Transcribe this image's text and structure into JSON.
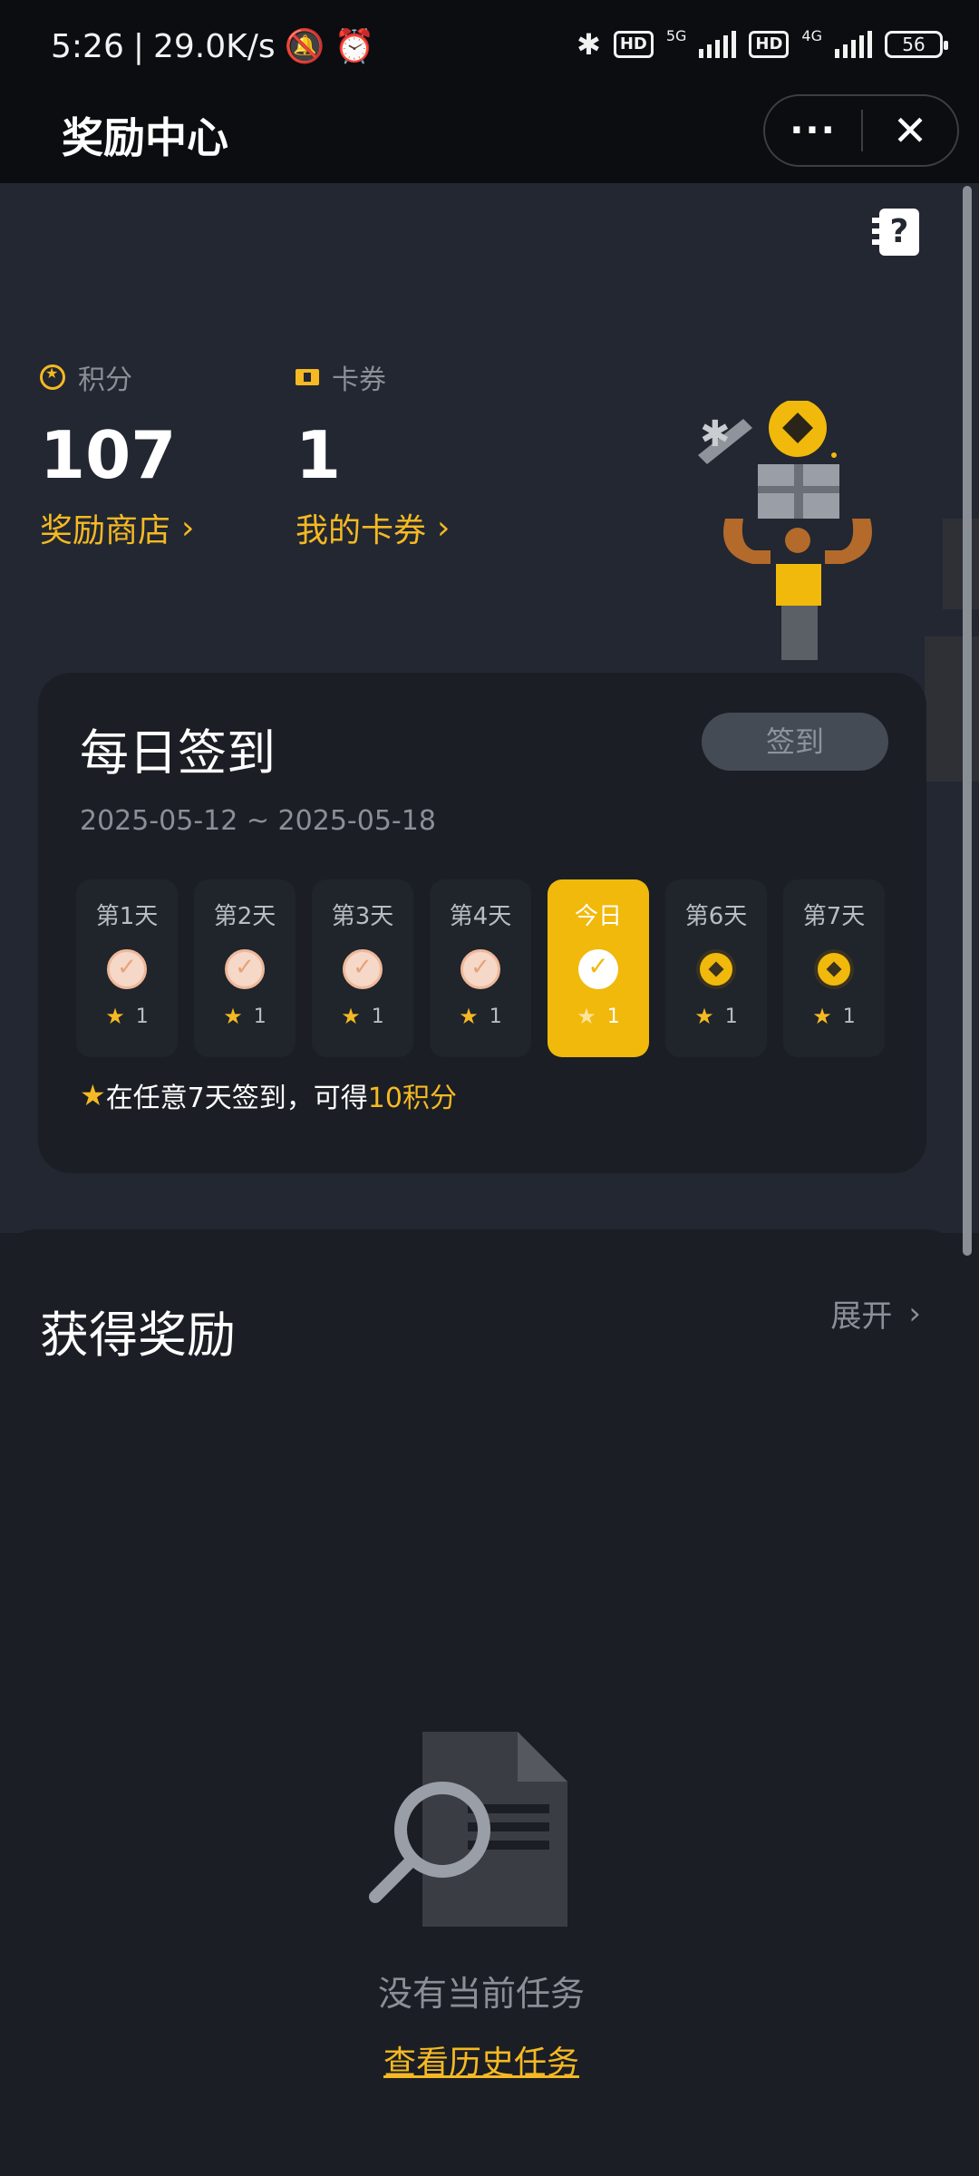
{
  "status_bar": {
    "time": "5:26",
    "network_speed": "29.0K/s",
    "sim1_label": "HD",
    "sim1_type": "5G",
    "sim2_label": "HD",
    "sim2_type": "4G",
    "battery": "56",
    "icons": [
      "mute-icon",
      "alarm-icon",
      "bluetooth-icon"
    ]
  },
  "titlebar": {
    "title": "奖励中心",
    "more_label": "···",
    "close_label": "✕"
  },
  "hero": {
    "help_icon": "?",
    "points": {
      "label": "积分",
      "value": "107",
      "link": "奖励商店",
      "chevron": "›"
    },
    "coupons": {
      "label": "卡券",
      "value": "1",
      "link": "我的卡券",
      "chevron": "›"
    }
  },
  "checkin": {
    "title": "每日签到",
    "button": "签到",
    "date_range": "2025-05-12 ~ 2025-05-18",
    "days": [
      {
        "label": "第1天",
        "reward": "1",
        "state": "done"
      },
      {
        "label": "第2天",
        "reward": "1",
        "state": "done"
      },
      {
        "label": "第3天",
        "reward": "1",
        "state": "done"
      },
      {
        "label": "第4天",
        "reward": "1",
        "state": "done"
      },
      {
        "label": "今日",
        "reward": "1",
        "state": "today"
      },
      {
        "label": "第6天",
        "reward": "1",
        "state": "pending"
      },
      {
        "label": "第7天",
        "reward": "1",
        "state": "pending"
      }
    ],
    "note_prefix": "在任意7天签到，可得",
    "note_highlight": "10积分"
  },
  "rewards": {
    "title": "获得奖励",
    "expand": "展开",
    "chevron": "›",
    "empty_text": "没有当前任务",
    "history_link": "查看历史任务"
  },
  "colors": {
    "accent": "#f0b90b",
    "link": "#f5b923",
    "background": "#1b1e24",
    "hero_bg": "#222731"
  }
}
